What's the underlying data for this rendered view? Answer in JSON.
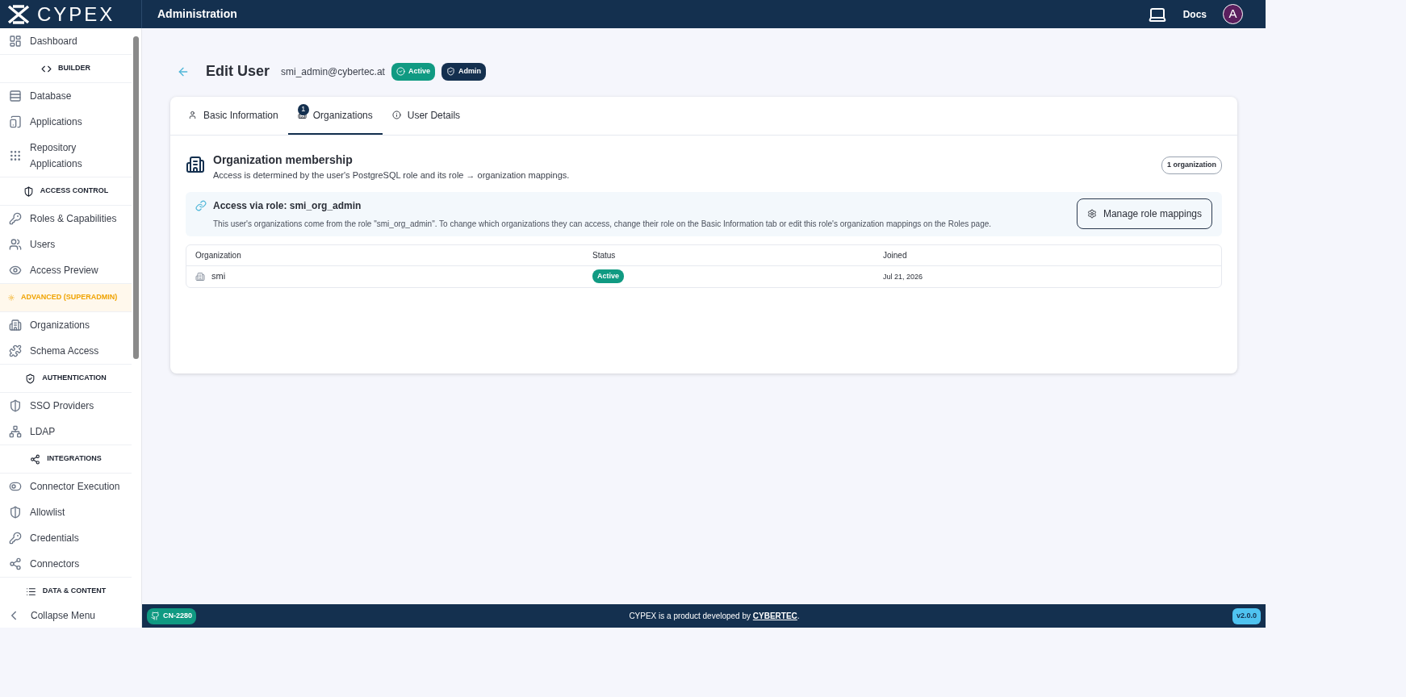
{
  "header": {
    "logo": "CYPEX",
    "title": "Administration",
    "docs": "Docs",
    "avatar": "A"
  },
  "sidebar": {
    "items": [
      {
        "kind": "item",
        "label": "Dashboard"
      },
      {
        "kind": "section",
        "label": "BUILDER",
        "highlighted": false
      },
      {
        "kind": "item",
        "label": "Database"
      },
      {
        "kind": "item",
        "label": "Applications"
      },
      {
        "kind": "item",
        "label": "Repository Applications"
      },
      {
        "kind": "section",
        "label": "ACCESS CONTROL",
        "highlighted": false
      },
      {
        "kind": "item",
        "label": "Roles & Capabilities"
      },
      {
        "kind": "item",
        "label": "Users"
      },
      {
        "kind": "item",
        "label": "Access Preview"
      },
      {
        "kind": "section",
        "label": "ADVANCED (SUPERADMIN)",
        "highlighted": true
      },
      {
        "kind": "item",
        "label": "Organizations"
      },
      {
        "kind": "item",
        "label": "Schema Access"
      },
      {
        "kind": "section",
        "label": "AUTHENTICATION",
        "highlighted": false
      },
      {
        "kind": "item",
        "label": "SSO Providers"
      },
      {
        "kind": "item",
        "label": "LDAP"
      },
      {
        "kind": "section",
        "label": "INTEGRATIONS",
        "highlighted": false
      },
      {
        "kind": "item",
        "label": "Connector Execution"
      },
      {
        "kind": "item",
        "label": "Allowlist"
      },
      {
        "kind": "item",
        "label": "Credentials"
      },
      {
        "kind": "item",
        "label": "Connectors"
      },
      {
        "kind": "section",
        "label": "DATA & CONTENT",
        "highlighted": false
      }
    ],
    "collapse": "Collapse Menu"
  },
  "page": {
    "title": "Edit User",
    "email": "smi_admin@cybertec.at",
    "badges": [
      "Active",
      "Admin"
    ]
  },
  "tabs": [
    {
      "label": "Basic Information",
      "selected": false
    },
    {
      "label": "Organizations",
      "selected": true,
      "badge": "1"
    },
    {
      "label": "User Details",
      "selected": false
    }
  ],
  "membership": {
    "title": "Organization membership",
    "description": "Access is determined by the user's PostgreSQL role and its role → organization mappings.",
    "count": "1 organization"
  },
  "role_notice": {
    "title": "Access via role: smi_org_admin",
    "text": "This user's organizations come from the role \"smi_org_admin\". To change which organizations they can access, change their role on the Basic Information tab or edit this role's organization mappings on the Roles page.",
    "button": "Manage role mappings"
  },
  "table": {
    "columns": [
      "Organization",
      "Status",
      "Joined"
    ],
    "rows": [
      {
        "organization": "smi",
        "status": "Active",
        "joined": "Jul 21, 2026"
      }
    ]
  },
  "footer": {
    "branch": "CN-2280",
    "text": "CYPEX is a product developed by ",
    "link": "CYBERTEC",
    "after": ".",
    "version": "v2.0.0"
  }
}
